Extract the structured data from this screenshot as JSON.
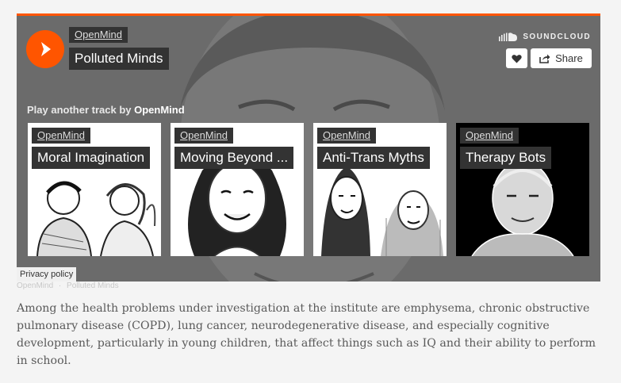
{
  "player": {
    "artist": "OpenMind",
    "track_title": "Polluted Minds",
    "brand": "SOUNDCLOUD",
    "share_label": "Share",
    "play_another_prefix": "Play another track by",
    "play_another_artist": "OpenMind"
  },
  "related_tracks": [
    {
      "artist": "OpenMind",
      "title": "Moral Imagination"
    },
    {
      "artist": "OpenMind",
      "title": "Moving Beyond ..."
    },
    {
      "artist": "OpenMind",
      "title": "Anti-Trans Myths"
    },
    {
      "artist": "OpenMind",
      "title": "Therapy Bots"
    }
  ],
  "privacy_label": "Privacy policy",
  "footer": {
    "artist_link": "OpenMind",
    "separator": "·",
    "track_link": "Polluted Minds"
  },
  "article": {
    "paragraph": "Among the health problems under investigation at the institute are emphysema, chronic obstructive pulmonary disease (COPD), lung cancer, neurodegenerative disease, and especially cognitive development, particularly in young children, that affect things such as IQ and their ability to perform in school."
  },
  "colors": {
    "accent": "#ff5500",
    "player_bg": "#6e6e6e",
    "label_bg": "#333333",
    "page_bg": "#f4f4f4"
  },
  "icons": [
    "play-icon",
    "soundcloud-logo-icon",
    "heart-icon",
    "share-icon"
  ]
}
